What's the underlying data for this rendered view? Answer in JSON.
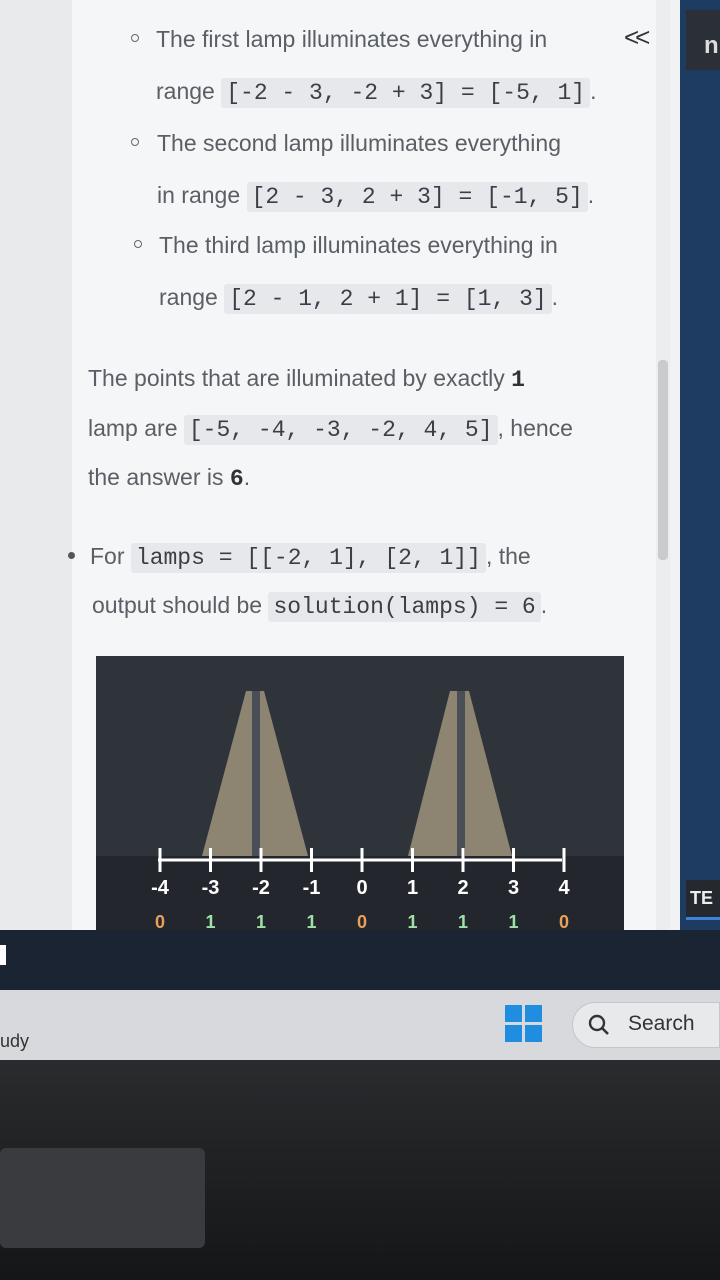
{
  "problem": {
    "sub_bullets": [
      {
        "text": "The first lamp illuminates everything in",
        "range_label": "range",
        "code": "[-2 - 3, -2 + 3] = [-5, 1]",
        "end": "."
      },
      {
        "text": "The second lamp illuminates everything",
        "range_label": "in range",
        "code": "[2 - 3, 2 + 3] = [-1, 5]",
        "end": "."
      },
      {
        "text": "The third lamp illuminates everything in",
        "range_label": "range",
        "code": "[2 - 1, 2 + 1] = [1, 3]",
        "end": "."
      }
    ],
    "summary": {
      "line1_text": "The points that are illuminated by exactly",
      "line1_code": "1",
      "line2_text": "lamp are",
      "line2_code": "[-5, -4, -3, -2, 4, 5]",
      "line2_after": ", hence",
      "line3_text": "the answer is",
      "line3_code": "6",
      "line3_end": "."
    },
    "example": {
      "prefix": "For",
      "code1": "lamps = [[-2, 1], [2, 1]]",
      "middle": ", the",
      "line2_text": "output should be",
      "code2": "solution(lamps) = 6",
      "end": "."
    }
  },
  "figure": {
    "axis_labels": [
      "-4",
      "-3",
      "-2",
      "-1",
      "0",
      "1",
      "2",
      "3",
      "4"
    ],
    "counts": [
      "0",
      "1",
      "1",
      "1",
      "0",
      "1",
      "1",
      "1",
      "0"
    ]
  },
  "right_panel": {
    "top_letter": "n",
    "tab_label": "TE"
  },
  "taskbar": {
    "search_label": "Search",
    "left_label": "udy"
  },
  "colors": {
    "page_bg": "#f5f6f7",
    "figure_bg": "#2f343b",
    "lamp_beam": "#8d8572",
    "accent": "#1f8de0"
  }
}
